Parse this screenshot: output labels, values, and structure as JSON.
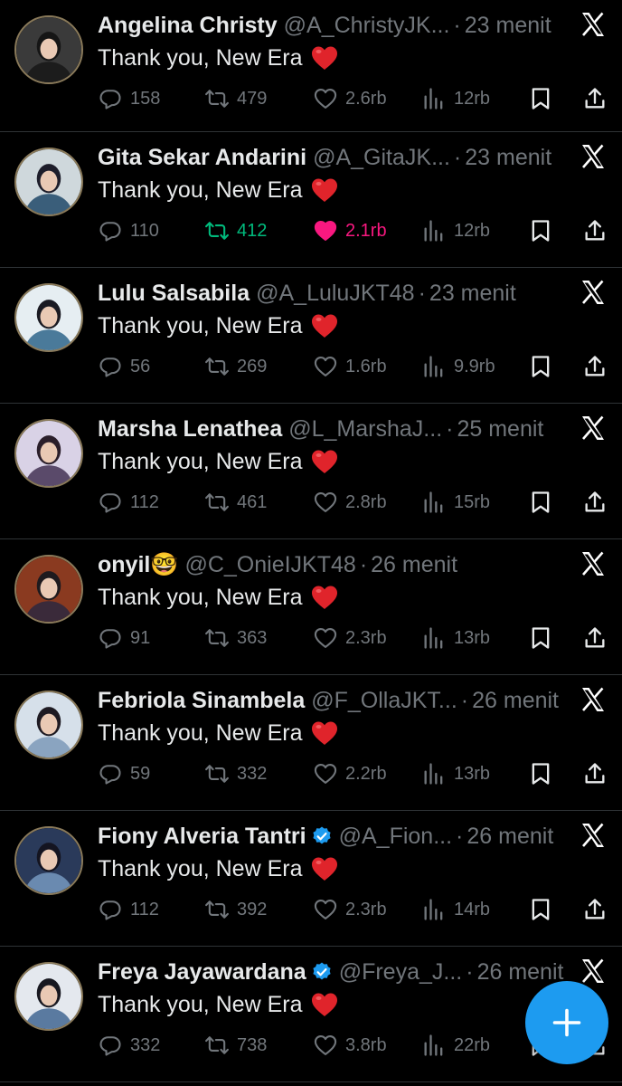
{
  "colors": {
    "background": "#000000",
    "text_primary": "#e7e9ea",
    "text_secondary": "#71767b",
    "divider": "#2f3336",
    "retweet_active": "#00ba7c",
    "like_active": "#f91880",
    "accent": "#1d9bf0",
    "emoji_heart": "#e0242b"
  },
  "icons": {
    "reply": "reply-icon",
    "retweet": "retweet-icon",
    "like": "like-icon",
    "views": "views-icon",
    "bookmark": "bookmark-icon",
    "share": "share-icon",
    "close": "x-close-icon",
    "verified": "verified-badge-icon",
    "compose": "plus-icon"
  },
  "tweets": [
    {
      "name": "Angelina Christy",
      "verified": false,
      "handle": "@A_ChristyJK...",
      "dot": "·",
      "time": "23 menit",
      "text": "Thank you, New Era",
      "emoji": "heart",
      "replies": "158",
      "retweets": "479",
      "likes": "2.6rb",
      "views": "12rb",
      "retweeted": false,
      "liked": false
    },
    {
      "name": "Gita Sekar Andarini",
      "verified": false,
      "handle": "@A_GitaJK...",
      "dot": "·",
      "time": "23 menit",
      "text": "Thank you, New Era",
      "emoji": "heart",
      "replies": "110",
      "retweets": "412",
      "likes": "2.1rb",
      "views": "12rb",
      "retweeted": true,
      "liked": true
    },
    {
      "name": "Lulu Salsabila",
      "verified": false,
      "handle": "@A_LuluJKT48",
      "dot": "·",
      "time": "23 menit",
      "text": "Thank you, New Era",
      "emoji": "heart",
      "replies": "56",
      "retweets": "269",
      "likes": "1.6rb",
      "views": "9.9rb",
      "retweeted": false,
      "liked": false
    },
    {
      "name": "Marsha Lenathea",
      "verified": false,
      "handle": "@L_MarshaJ...",
      "dot": "·",
      "time": "25 menit",
      "text": "Thank you, New Era",
      "emoji": "heart",
      "replies": "112",
      "retweets": "461",
      "likes": "2.8rb",
      "views": "15rb",
      "retweeted": false,
      "liked": false
    },
    {
      "name": "onyil🤓",
      "verified": false,
      "handle": "@C_OnieIJKT48",
      "dot": "·",
      "time": "26 menit",
      "text": "Thank you, New Era",
      "emoji": "heart",
      "replies": "91",
      "retweets": "363",
      "likes": "2.3rb",
      "views": "13rb",
      "retweeted": false,
      "liked": false
    },
    {
      "name": "Febriola Sinambela",
      "verified": false,
      "handle": "@F_OllaJKT...",
      "dot": "·",
      "time": "26 menit",
      "text": "Thank you, New Era",
      "emoji": "heart",
      "replies": "59",
      "retweets": "332",
      "likes": "2.2rb",
      "views": "13rb",
      "retweeted": false,
      "liked": false
    },
    {
      "name": "Fiony Alveria Tantri",
      "verified": true,
      "handle": "@A_Fion...",
      "dot": "·",
      "time": "26 menit",
      "text": "Thank you, New Era",
      "emoji": "heart",
      "replies": "112",
      "retweets": "392",
      "likes": "2.3rb",
      "views": "14rb",
      "retweeted": false,
      "liked": false
    },
    {
      "name": "Freya Jayawardana",
      "verified": true,
      "handle": "@Freya_J...",
      "dot": "·",
      "time": "26 menit",
      "text": "Thank you, New Era",
      "emoji": "heart",
      "replies": "332",
      "retweets": "738",
      "likes": "3.8rb",
      "views": "22rb",
      "retweeted": false,
      "liked": false
    }
  ],
  "fab": {
    "icon": "plus-icon",
    "color": "#1d9bf0"
  }
}
